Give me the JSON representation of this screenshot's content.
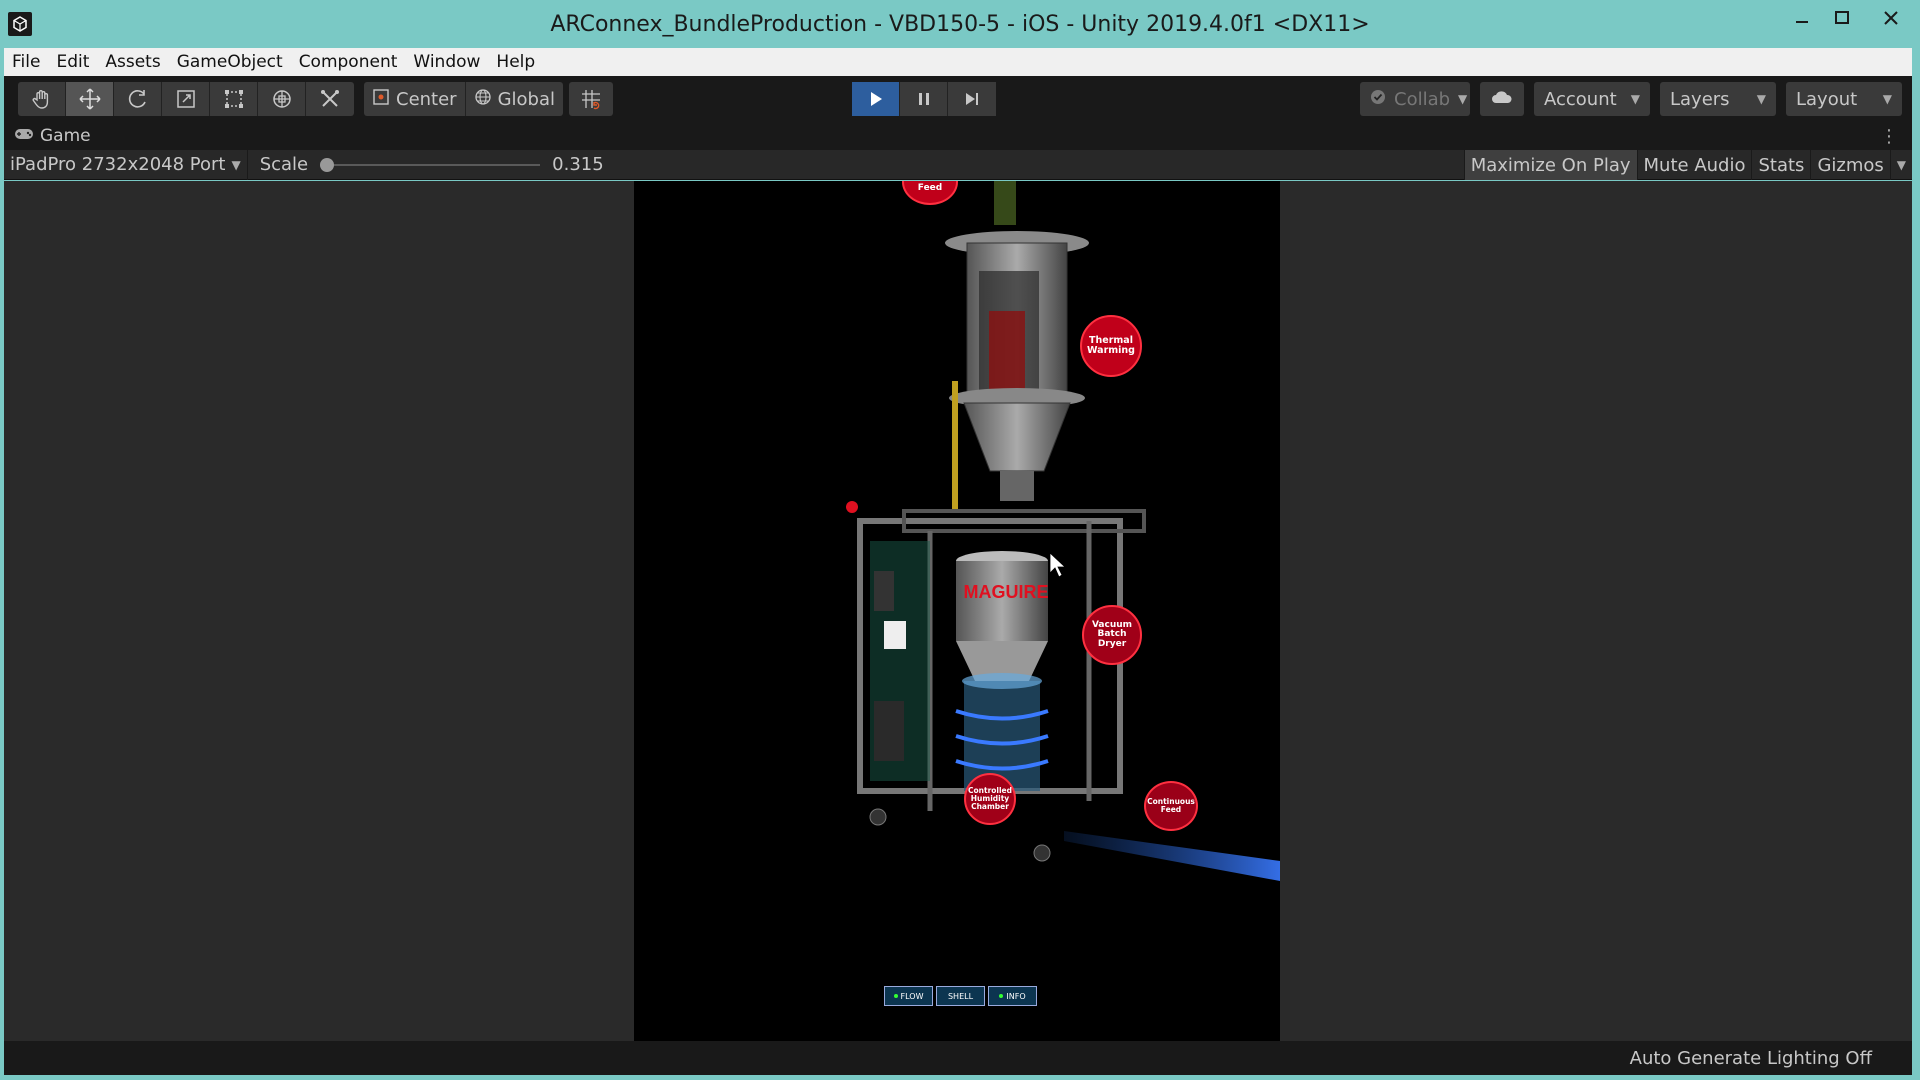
{
  "window": {
    "title": "ARConnex_BundleProduction - VBD150-5 - iOS - Unity 2019.4.0f1 <DX11>",
    "controls": [
      "minimize-icon",
      "maximize-icon",
      "close-icon"
    ]
  },
  "menu": {
    "items": [
      "File",
      "Edit",
      "Assets",
      "GameObject",
      "Component",
      "Window",
      "Help"
    ]
  },
  "toolbar": {
    "tools": [
      "hand-icon",
      "move-icon",
      "rotate-icon",
      "scale-icon",
      "rect-icon",
      "transform-icon",
      "custom-tool-icon"
    ],
    "active_tool": "move-icon",
    "pivot_label": "Center",
    "space_label": "Global",
    "collab_label": "Collab",
    "account_label": "Account",
    "layers_label": "Layers",
    "layout_label": "Layout"
  },
  "tab": {
    "label": "Game"
  },
  "gamebar": {
    "resolution": "iPadPro 2732x2048 Port",
    "scale_label": "Scale",
    "scale_value": "0.315",
    "scale_fraction": 0.0,
    "maximize_label": "Maximize On Play",
    "mute_label": "Mute Audio",
    "stats_label": "Stats",
    "gizmos_label": "Gizmos"
  },
  "scene": {
    "labels": {
      "feed": "Feed",
      "thermal": [
        "Thermal",
        "Warming"
      ],
      "vacuum": [
        "Vacuum",
        "Batch",
        "Dryer"
      ],
      "humidity": [
        "Controlled",
        "Humidity",
        "Chamber"
      ],
      "continuous": [
        "Continuous",
        "Feed"
      ],
      "brand": "MAGUIRE"
    },
    "ui_buttons": [
      "FLOW",
      "SHELL",
      "INFO"
    ]
  },
  "status": {
    "text": "Auto Generate Lighting Off"
  },
  "colors": {
    "accent_blue": "#2d5e9e",
    "label_red": "#c0001a"
  }
}
